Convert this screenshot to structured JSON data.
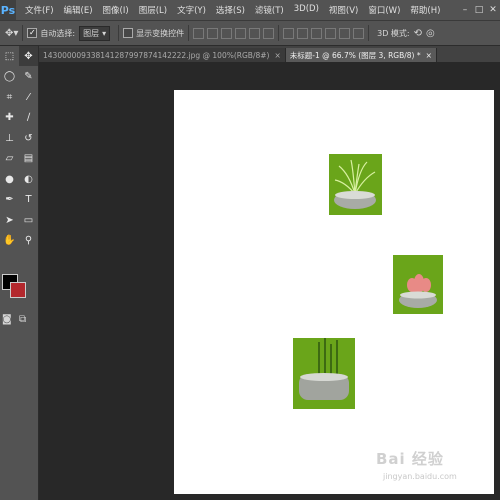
{
  "app": {
    "logo": "Ps"
  },
  "menus": [
    "文件(F)",
    "编辑(E)",
    "图像(I)",
    "图层(L)",
    "文字(Y)",
    "选择(S)",
    "滤镜(T)",
    "3D(D)",
    "视图(V)",
    "窗口(W)",
    "帮助(H)"
  ],
  "window_controls": {
    "minimize": "–",
    "restore": "□",
    "close": "✕"
  },
  "options": {
    "auto_select_label": "自动选择:",
    "auto_select_checked": true,
    "layer_dropdown": "图层",
    "show_transform_label": "显示变换控件",
    "mode_3d_label": "3D 模式:"
  },
  "tabs": [
    {
      "label": "143000009338141287997874142222.jpg @ 100%(RGB/8#)",
      "close": "×",
      "active": false
    },
    {
      "label": "未标题-1 @ 66.7% (图层 3, RGB/8) *",
      "close": "×",
      "active": true
    }
  ],
  "colors": {
    "foreground": "#000000",
    "background": "#b3282d",
    "accent": "#5ab3ff"
  },
  "tools": [
    "move-tool",
    "marquee-tool",
    "lasso-tool",
    "quick-select-tool",
    "crop-tool",
    "eyedropper-tool",
    "healing-brush-tool",
    "brush-tool",
    "clone-stamp-tool",
    "history-brush-tool",
    "eraser-tool",
    "gradient-tool",
    "blur-tool",
    "dodge-tool",
    "pen-tool",
    "type-tool",
    "path-select-tool",
    "shape-tool",
    "hand-tool",
    "zoom-tool"
  ],
  "watermark": {
    "text": "Bai 经验",
    "url": "jingyan.baidu.com"
  }
}
